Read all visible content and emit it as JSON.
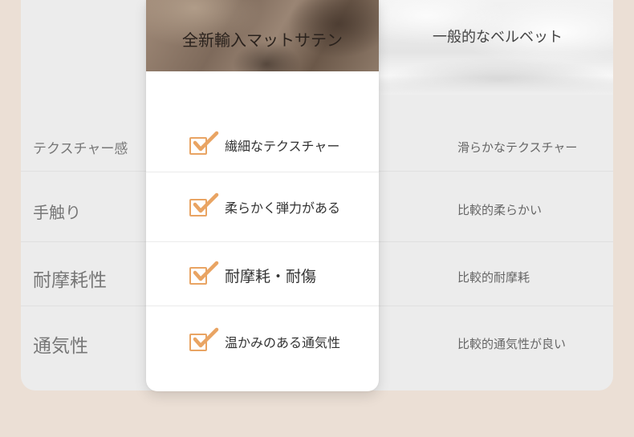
{
  "columns": {
    "satin_title": "全新輸入マットサテン",
    "velvet_title": "一般的なベルベット"
  },
  "rows": [
    {
      "label": "テクスチャー感",
      "satin": "繊細なテクスチャー",
      "velvet": "滑らかなテクスチャー"
    },
    {
      "label": "手触り",
      "satin": "柔らかく弾力がある",
      "velvet": "比較的柔らかい"
    },
    {
      "label": "耐摩耗性",
      "satin": "耐摩耗・耐傷",
      "velvet": "比較的耐摩耗"
    },
    {
      "label": "通気性",
      "satin": "温かみのある通気性",
      "velvet": "比較的通気性が良い"
    }
  ],
  "icons": {
    "check": "checkmark-icon"
  },
  "colors": {
    "accent": "#e9a463",
    "background": "#ebdfd5",
    "panel": "#ececec",
    "card": "#ffffff"
  }
}
